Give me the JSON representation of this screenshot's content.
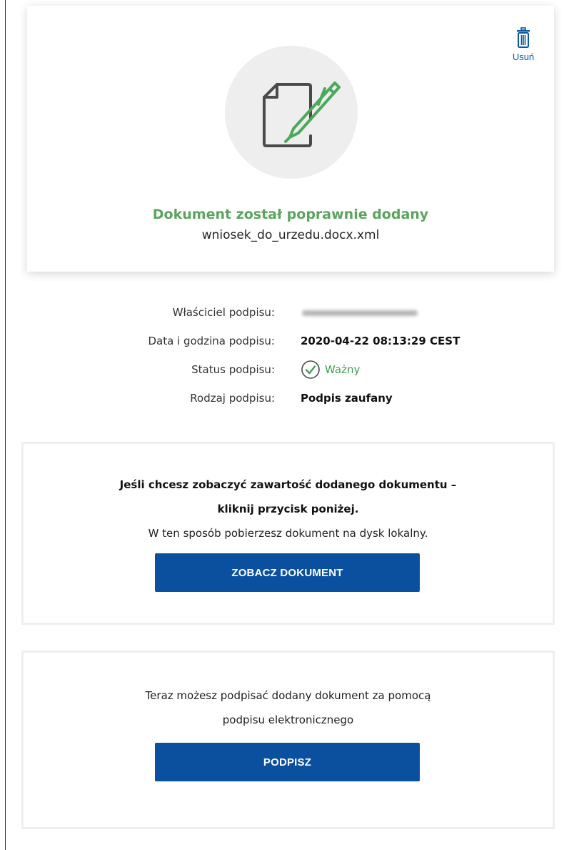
{
  "upload": {
    "delete_label": "Usuń",
    "success_title": "Dokument został poprawnie dodany",
    "file_name": "wniosek_do_urzedu.docx.xml"
  },
  "signature": {
    "owner_label": "Właściciel podpisu:",
    "datetime_label": "Data i godzina podpisu:",
    "datetime_value": "2020-04-22 08:13:29 CEST",
    "status_label": "Status podpisu:",
    "status_value": "Ważny",
    "type_label": "Rodzaj podpisu:",
    "type_value": "Podpis zaufany"
  },
  "view_panel": {
    "heading_line1": "Jeśli chcesz zobaczyć zawartość dodanego dokumentu –",
    "heading_line2": "kliknij przycisk poniżej.",
    "description": "W ten sposób pobierzesz dokument na dysk lokalny.",
    "button_label": "ZOBACZ DOKUMENT"
  },
  "sign_panel": {
    "line1": "Teraz możesz podpisać dodany dokument za pomocą",
    "line2": "podpisu elektronicznego",
    "button_label": "PODPISZ"
  },
  "colors": {
    "accent_blue": "#0b4f9f",
    "success_green": "#5aa55e",
    "link_blue": "#0b5aa4"
  }
}
